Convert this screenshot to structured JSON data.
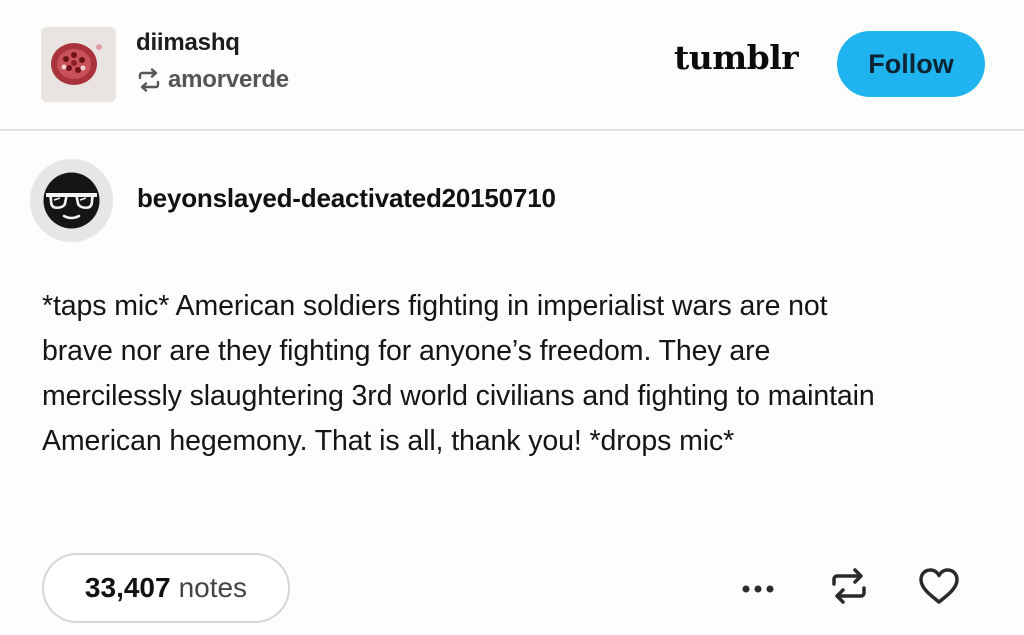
{
  "header": {
    "blog_name": "diimashq",
    "reblogged_from": "amorverde",
    "reblog_icon": "reblog-icon",
    "avatar": "pomegranate-avatar",
    "logo_text": "tumblr",
    "follow_label": "Follow",
    "follow_color": "#1fb4ef"
  },
  "post": {
    "author": "beyonslayed-deactivated20150710",
    "avatar": "sunglasses-avatar",
    "body_lines": [
      "*taps mic* American soldiers fighting in imperialist wars are not",
      "brave nor are they fighting for anyone’s freedom. They are",
      "mercilessly slaughtering 3rd world civilians and fighting to maintain",
      "American hegemony. That is all, thank you! *drops mic*"
    ]
  },
  "footer": {
    "notes_count": "33,407",
    "notes_label": "notes",
    "more_icon": "more-icon",
    "reblog_icon": "reblog-icon",
    "like_icon": "heart-icon"
  }
}
